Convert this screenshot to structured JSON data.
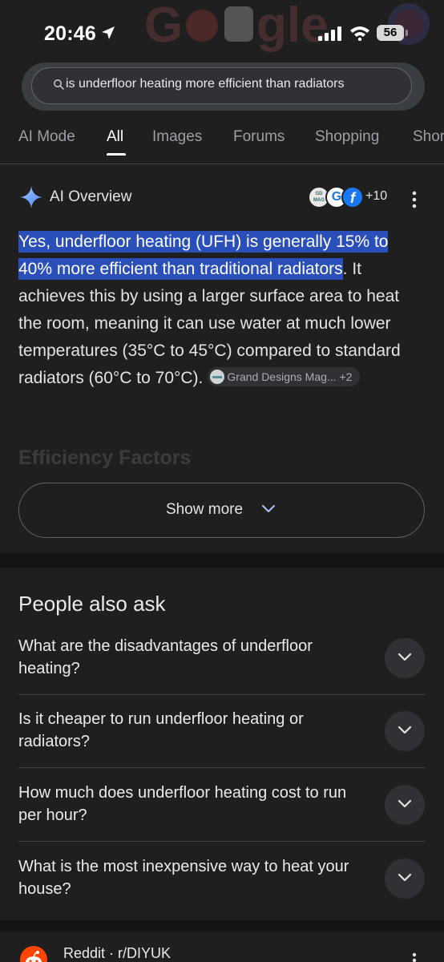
{
  "status_bar": {
    "time": "20:46",
    "battery": "56"
  },
  "search": {
    "query": "is underfloor heating more efficient than radiators"
  },
  "tabs": [
    {
      "label": "AI Mode"
    },
    {
      "label": "All"
    },
    {
      "label": "Images"
    },
    {
      "label": "Forums"
    },
    {
      "label": "Shopping"
    },
    {
      "label": "Shor"
    }
  ],
  "ai_overview": {
    "title": "AI Overview",
    "source_count": "+10",
    "highlight": "Yes, underfloor heating (UFH) is generally 15% to 40% more efficient than traditional radiators",
    "body": ". It achieves this by using a larger surface area to heat the room, meaning it can use water at much lower temperatures (35°C to 45°C) compared to standard radiators (60°C to 70°C).",
    "citation_label": "Grand Designs Mag...",
    "citation_extra": "+2",
    "faded_heading": "Efficiency Factors",
    "show_more": "Show more"
  },
  "people_also_ask": {
    "title": "People also ask",
    "questions": [
      "What are the disadvantages of underfloor heating?",
      "Is it cheaper to run underfloor heating or radiators?",
      "How much does underfloor heating cost to run per hour?",
      "What is the most inexpensive way to heat your house?"
    ]
  },
  "result": {
    "source": "Reddit · r/DIYUK"
  },
  "colors": {
    "background": "#1f1f1f",
    "highlight": "#2a4fb8",
    "reddit": "#ff4500"
  }
}
